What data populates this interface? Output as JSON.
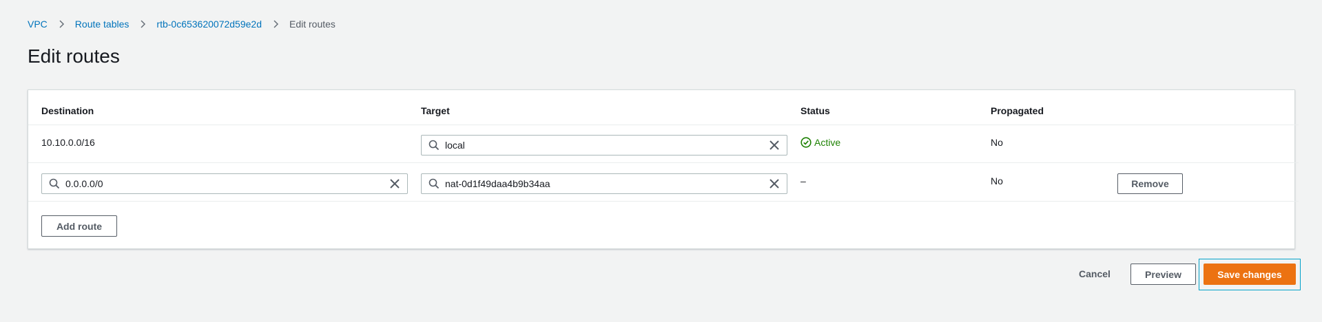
{
  "breadcrumb": {
    "items": [
      "VPC",
      "Route tables",
      "rtb-0c653620072d59e2d"
    ],
    "current": "Edit routes"
  },
  "page": {
    "title": "Edit routes"
  },
  "table": {
    "headers": {
      "destination": "Destination",
      "target": "Target",
      "status": "Status",
      "propagated": "Propagated"
    },
    "rows": [
      {
        "destination": "10.10.0.0/16",
        "target": "local",
        "status": "Active",
        "propagated": "No"
      },
      {
        "destination": "0.0.0.0/0",
        "target": "nat-0d1f49daa4b9b34aa",
        "status": "–",
        "propagated": "No",
        "remove_label": "Remove"
      }
    ],
    "add_route_label": "Add route"
  },
  "footer": {
    "cancel_label": "Cancel",
    "preview_label": "Preview",
    "save_label": "Save changes"
  },
  "colors": {
    "link": "#0073bb",
    "primary": "#ec7211",
    "success": "#1d8102",
    "focus": "#00a1c9"
  }
}
